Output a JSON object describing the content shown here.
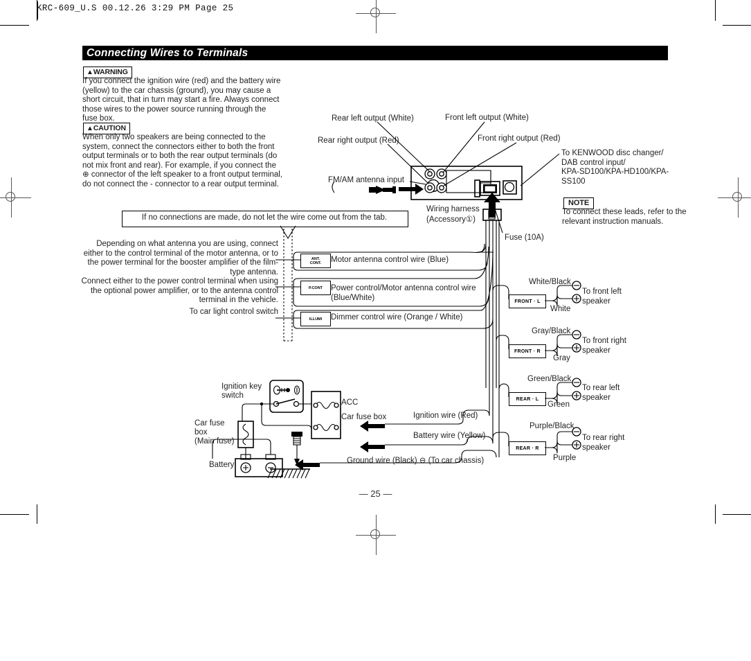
{
  "print_header": "KRC-609_U.S  00.12.26 3:29 PM  Page 25",
  "title": "Connecting Wires to Terminals",
  "warning": {
    "tag": "WARNING",
    "body": "If you connect the ignition wire (red) and the battery wire (yellow) to the car chassis (ground), you may cause a short circuit, that in turn may start a fire. Always connect those wires to the power source running through the fuse box."
  },
  "caution": {
    "tag": "CAUTION",
    "body": "When only two speakers are being connected to the system, connect the connectors either to both the front output terminals or to both the rear output terminals (do not mix front and rear). For example, if you connect the ⊕ connector of the left speaker to a front output terminal, do not connect the - connector to a rear output terminal."
  },
  "note": {
    "tag": "NOTE",
    "body": "To connect these leads, refer to the relevant instruction manuals."
  },
  "tab_callout": "If no connections are made, do not let the wire come out from the tab.",
  "unit_labels": {
    "rear_left_output": "Rear left output (White)",
    "rear_right_output": "Rear right output (Red)",
    "front_left_output": "Front left output (White)",
    "front_right_output": "Front right output (Red)",
    "antenna_input": "FM/AM antenna input",
    "wiring_harness": "Wiring harness\n(Accessory①)",
    "wiring_harness_l1": "Wiring harness",
    "wiring_harness_l2": "(Accessory①)",
    "fuse": "Fuse (10A)",
    "kenwood_l1": "To KENWOOD disc changer/",
    "kenwood_l2": "DAB control input/",
    "kenwood_l3": "KPA-SD100/KPA-HD100/KPA-",
    "kenwood_l4": "SS100"
  },
  "instructions": [
    "Depending on what antenna you are using, connect either to the control terminal of the motor antenna, or to the power terminal for the booster amplifier of the film-type antenna.",
    "Connect either to the power control terminal when using the optional power amplifier, or to the antenna control terminal in the vehicle.",
    "To car light control switch"
  ],
  "control_wires": [
    {
      "chip_l1": "ANT.",
      "chip_l2": "CONT.",
      "label_l1": "Motor antenna control wire (Blue)",
      "label_l2": ""
    },
    {
      "chip_l1": "P.CONT",
      "chip_l2": "",
      "label_l1": "Power control/Motor antenna control wire",
      "label_l2": "(Blue/White)"
    },
    {
      "chip_l1": "ILLUMI",
      "chip_l2": "",
      "label_l1": "Dimmer control wire (Orange / White)",
      "label_l2": ""
    }
  ],
  "speakers": [
    {
      "terminal": "FRONT · L",
      "neg_wire": "White/Black",
      "pos_wire": "White",
      "dest_l1": "To front left",
      "dest_l2": "speaker"
    },
    {
      "terminal": "FRONT · R",
      "neg_wire": "Gray/Black",
      "pos_wire": "Gray",
      "dest_l1": "To front right",
      "dest_l2": "speaker"
    },
    {
      "terminal": "REAR · L",
      "neg_wire": "Green/Black",
      "pos_wire": "Green",
      "dest_l1": "To rear left",
      "dest_l2": "speaker"
    },
    {
      "terminal": "REAR · R",
      "neg_wire": "Purple/Black",
      "pos_wire": "Purple",
      "dest_l1": "To rear right",
      "dest_l2": "speaker"
    }
  ],
  "power": {
    "ignition_key_l1": "Ignition key",
    "ignition_key_l2": "switch",
    "car_fuse_box_main_l1": "Car fuse",
    "car_fuse_box_main_l2": "box",
    "car_fuse_box_main_l3": "(Main fuse)",
    "battery": "Battery",
    "acc": "ACC",
    "car_fuse_box": "Car fuse box",
    "ignition_wire": "Ignition wire (Red)",
    "battery_wire": "Battery wire (Yellow)",
    "ground_wire": "Ground wire (Black) ⊖ (To car chassis)"
  },
  "page_number": "— 25 —"
}
